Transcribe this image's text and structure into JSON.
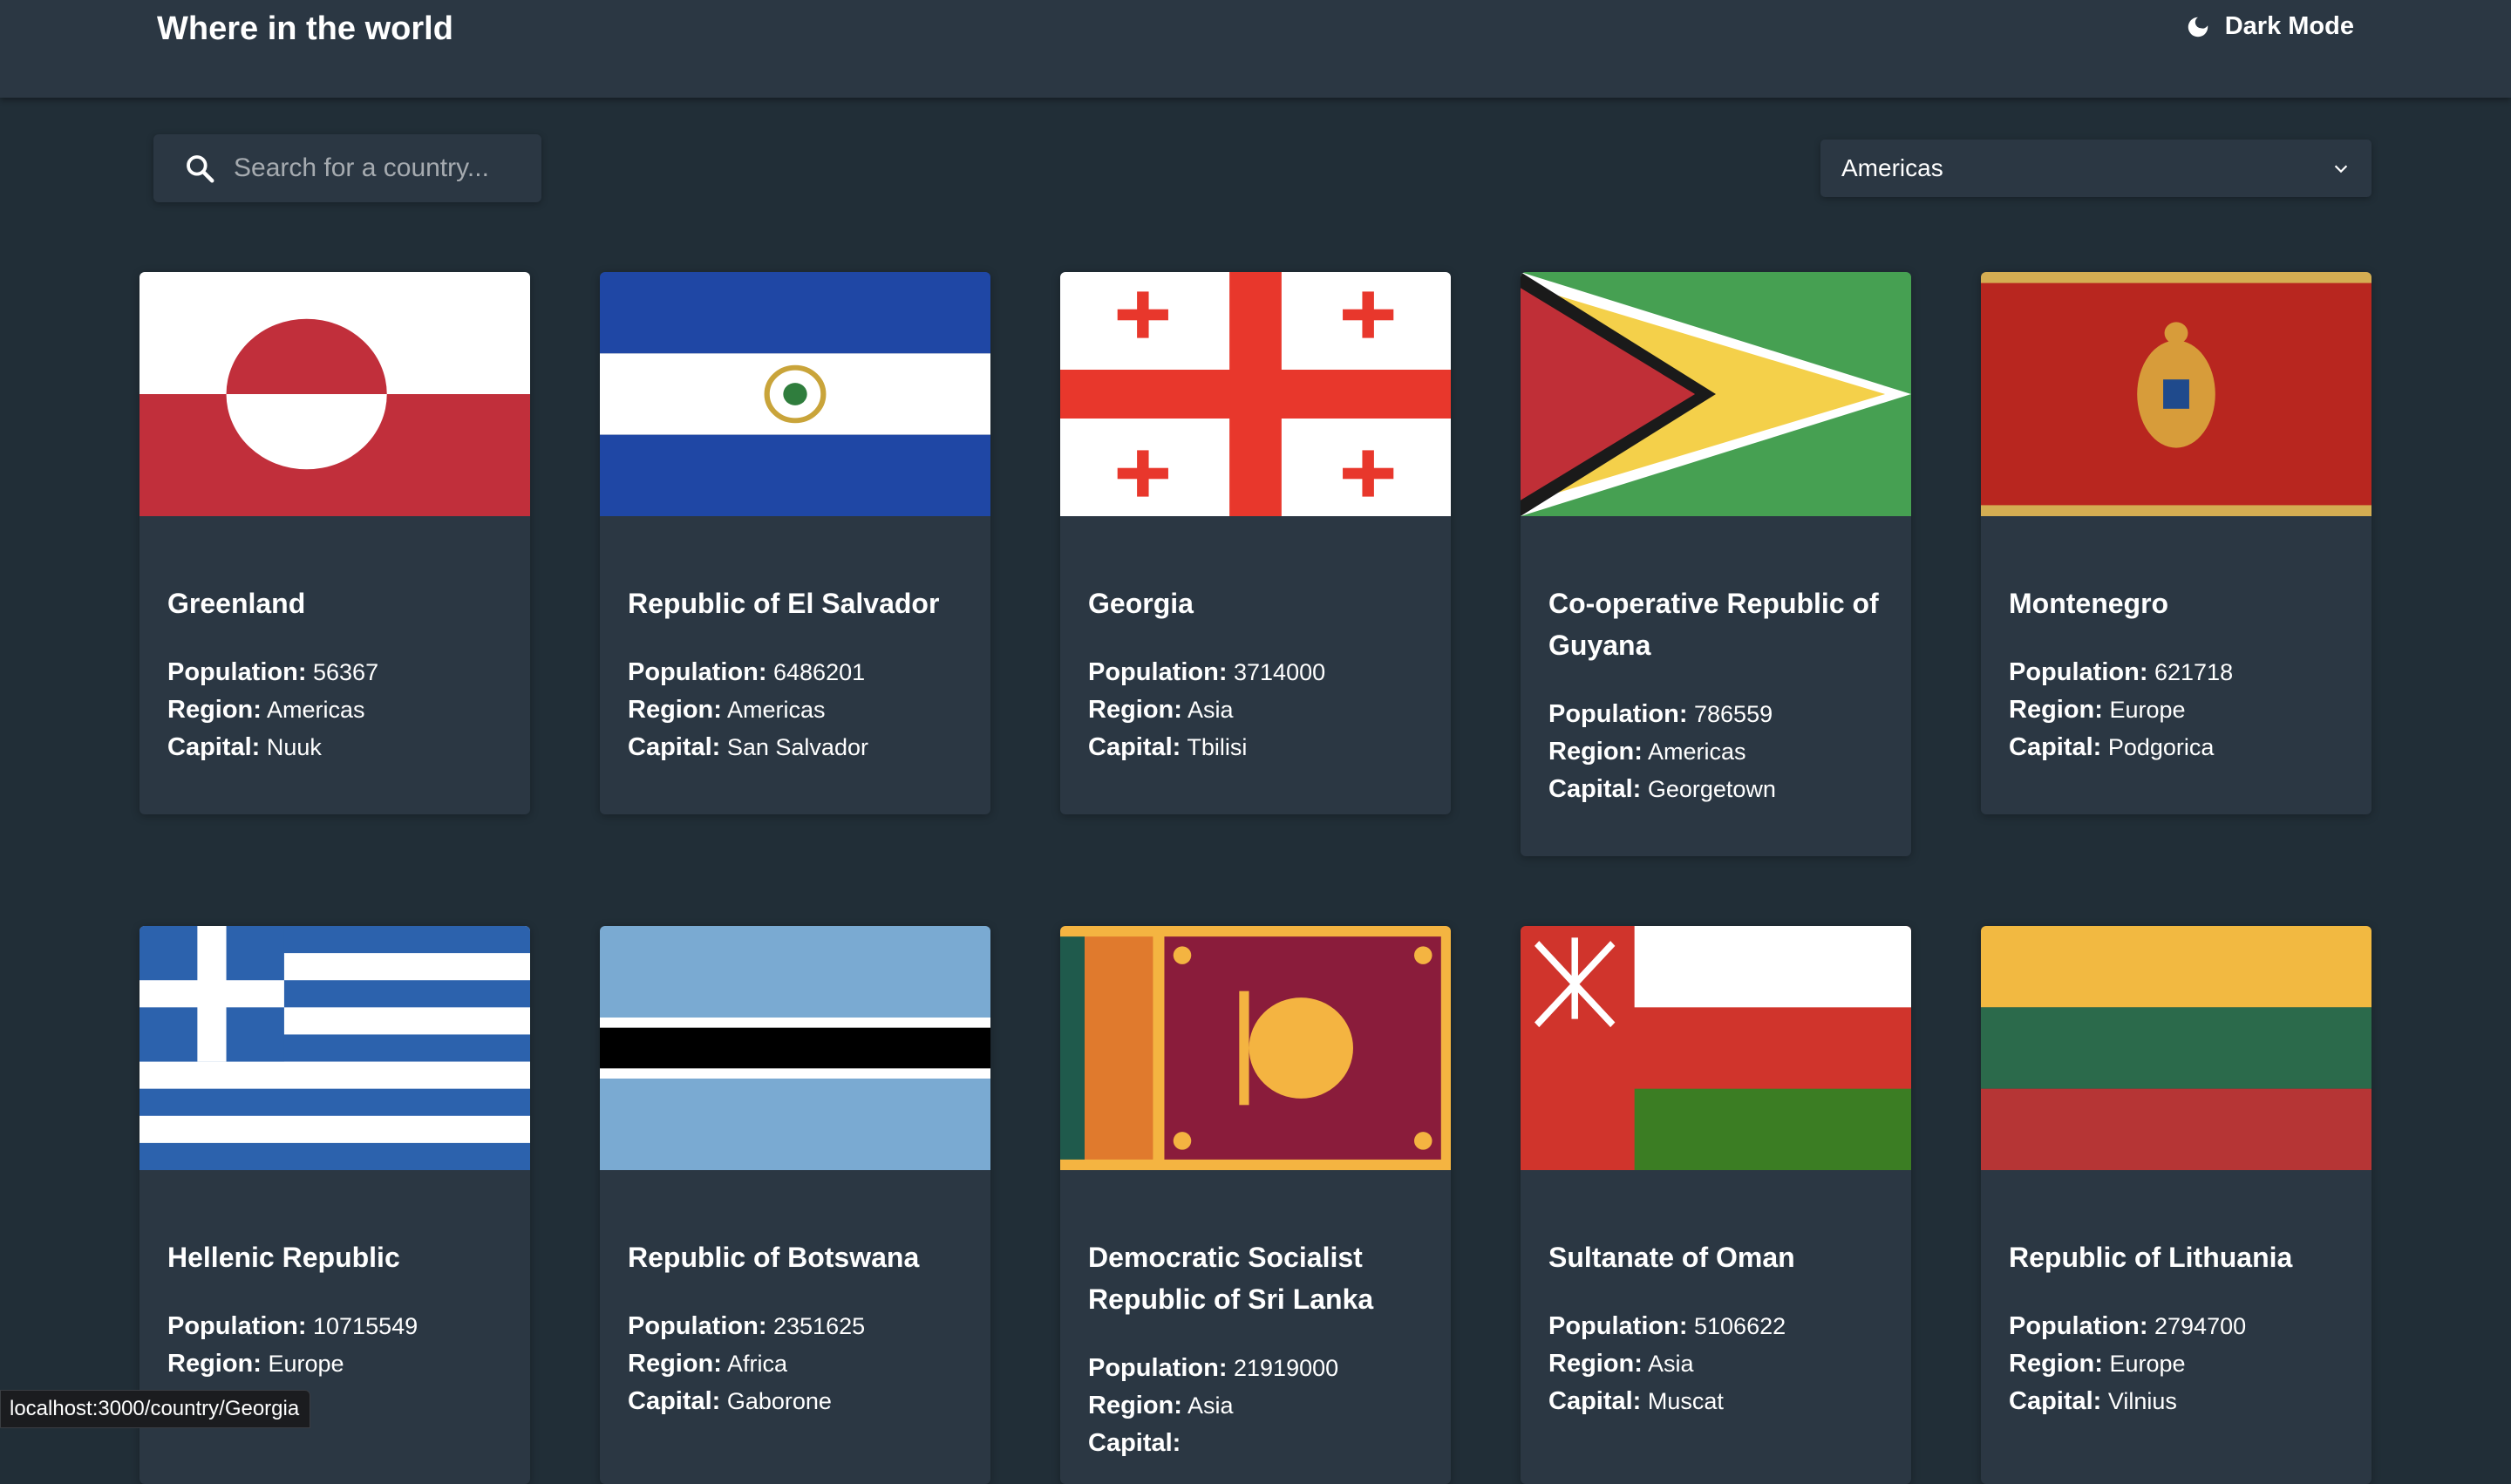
{
  "header": {
    "title": "Where in the world",
    "theme_label": "Dark Mode"
  },
  "search": {
    "placeholder": "Search for a country..."
  },
  "filter": {
    "selected": "Americas"
  },
  "labels": {
    "population": "Population:",
    "region": "Region:",
    "capital": "Capital:"
  },
  "countries": [
    {
      "name": "Greenland",
      "population": "56367",
      "region": "Americas",
      "capital": "Nuuk"
    },
    {
      "name": "Republic of El Salvador",
      "population": "6486201",
      "region": "Americas",
      "capital": "San Salvador"
    },
    {
      "name": "Georgia",
      "population": "3714000",
      "region": "Asia",
      "capital": "Tbilisi"
    },
    {
      "name": "Co-operative Republic of Guyana",
      "population": "786559",
      "region": "Americas",
      "capital": "Georgetown"
    },
    {
      "name": "Montenegro",
      "population": "621718",
      "region": "Europe",
      "capital": "Podgorica"
    },
    {
      "name": "Hellenic Republic",
      "population": "10715549",
      "region": "Europe",
      "capital": ""
    },
    {
      "name": "Republic of Botswana",
      "population": "2351625",
      "region": "Africa",
      "capital": "Gaborone"
    },
    {
      "name": "Democratic Socialist Republic of Sri Lanka",
      "population": "21919000",
      "region": "Asia",
      "capital": ""
    },
    {
      "name": "Sultanate of Oman",
      "population": "5106622",
      "region": "Asia",
      "capital": "Muscat"
    },
    {
      "name": "Republic of Lithuania",
      "population": "2794700",
      "region": "Europe",
      "capital": "Vilnius"
    }
  ],
  "status_bar": {
    "url": "localhost:3000/country/Georgia"
  },
  "colors": {
    "background": "#212e37",
    "element": "#2b3743",
    "text": "#ffffff",
    "placeholder": "#a6abb0"
  }
}
